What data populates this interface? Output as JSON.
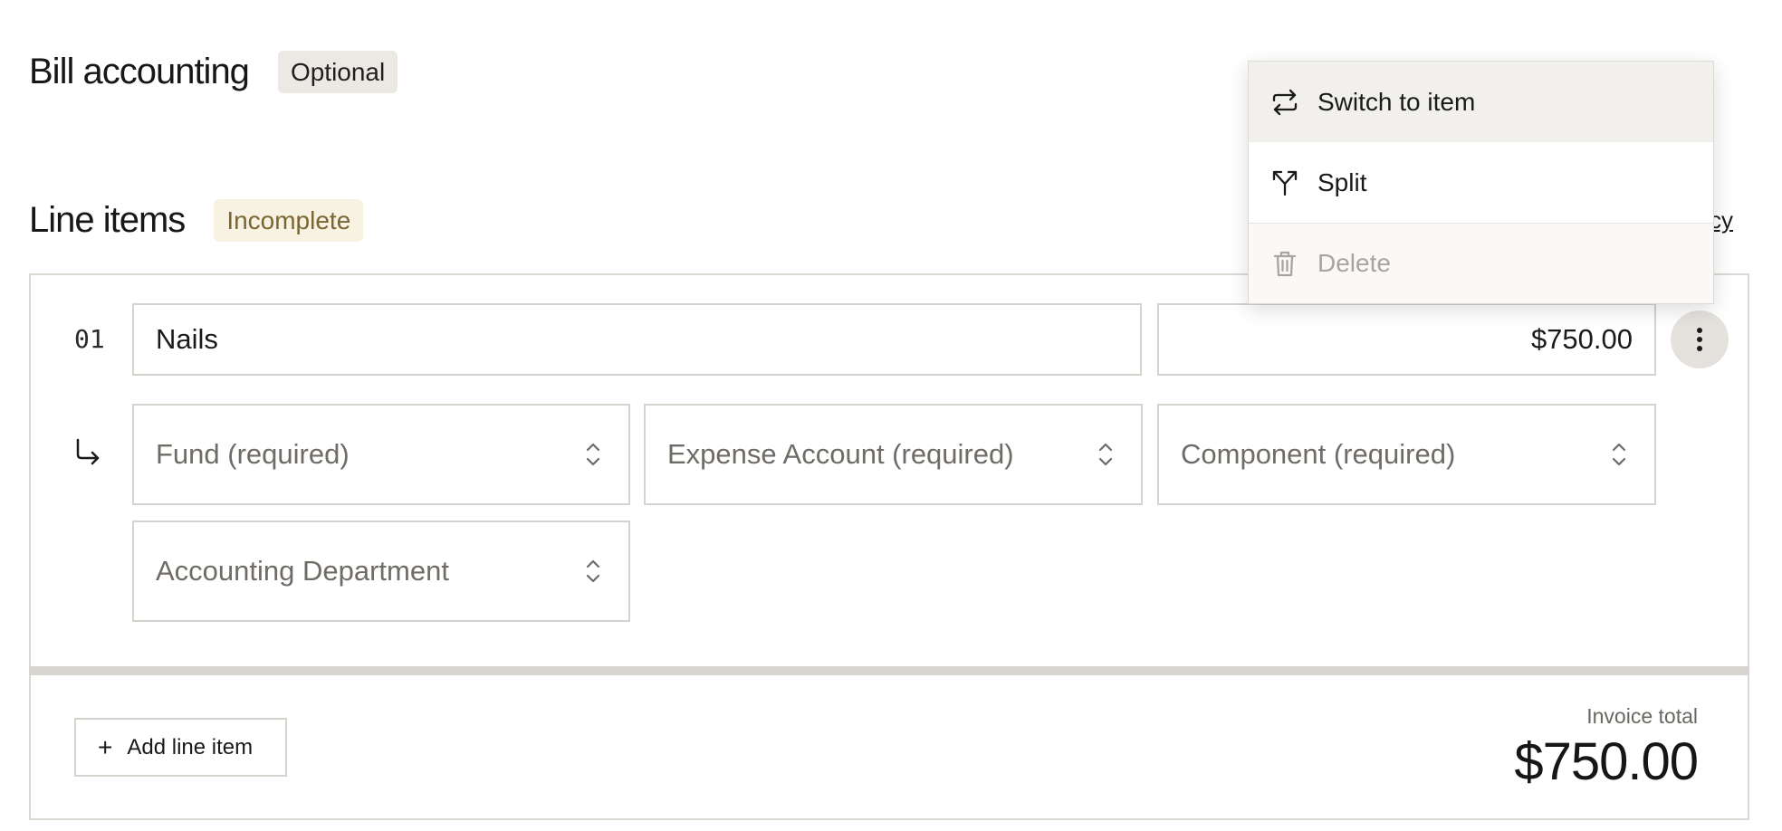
{
  "bill_accounting": {
    "title": "Bill accounting",
    "badge": "Optional"
  },
  "line_items": {
    "title": "Line items",
    "badge": "Incomplete",
    "partial_link": "cy",
    "rows": [
      {
        "number": "01",
        "description": "Nails",
        "amount": "$750.00",
        "fund_placeholder": "Fund (required)",
        "expense_account_placeholder": "Expense Account (required)",
        "component_placeholder": "Component (required)",
        "accounting_department_placeholder": "Accounting Department"
      }
    ],
    "add_button_label": "Add line item"
  },
  "invoice": {
    "total_label": "Invoice total",
    "total_value": "$750.00"
  },
  "context_menu": {
    "items": [
      {
        "label": "Switch to item",
        "icon": "switch-arrows-icon",
        "state": "hover"
      },
      {
        "label": "Split",
        "icon": "split-icon",
        "state": "normal"
      },
      {
        "label": "Delete",
        "icon": "trash-icon",
        "state": "disabled"
      }
    ]
  },
  "colors": {
    "text": "#1a1a1a",
    "muted_text": "#6f6b67",
    "border": "#d6d2ce",
    "optional_badge_bg": "#ece9e5",
    "incomplete_badge_bg": "#f7f2e1",
    "incomplete_badge_text": "#7a6632",
    "menu_hover_bg": "#f2f0ed",
    "disabled_text": "#a8a4a0"
  }
}
